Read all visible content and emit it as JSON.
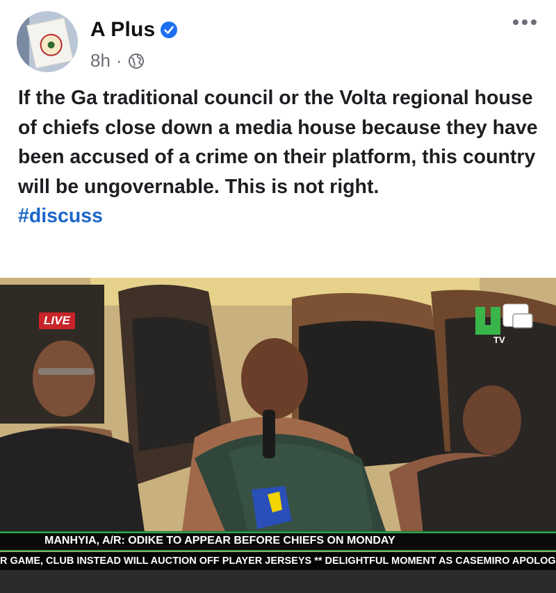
{
  "post": {
    "author": "A Plus",
    "time": "8h",
    "separator": "·",
    "text": "If the Ga traditional council or the Volta regional house of chiefs close down a media house because they have been accused of a crime on their platform, this country will be ungovernable. This is not right.",
    "hashtag": "#discuss"
  },
  "video": {
    "live_label": "LIVE",
    "channel_logo_text": "TV",
    "headline": "MANHYIA, A/R: ODIKE TO APPEAR BEFORE CHIEFS ON MONDAY",
    "ticker": "R GAME, CLUB INSTEAD WILL AUCTION OFF PLAYER JERSEYS    ** DELIGHTFUL MOMENT AS CASEMIRO APOLOGISES TO"
  },
  "icons": {
    "verified": "verified-badge-icon",
    "audience": "globe-icon",
    "menu": "more-options-icon"
  },
  "colors": {
    "hashtag": "#1b66c9",
    "verified": "#1d6ff2",
    "live": "#c8242a",
    "headline_accent": "#35a34a"
  }
}
